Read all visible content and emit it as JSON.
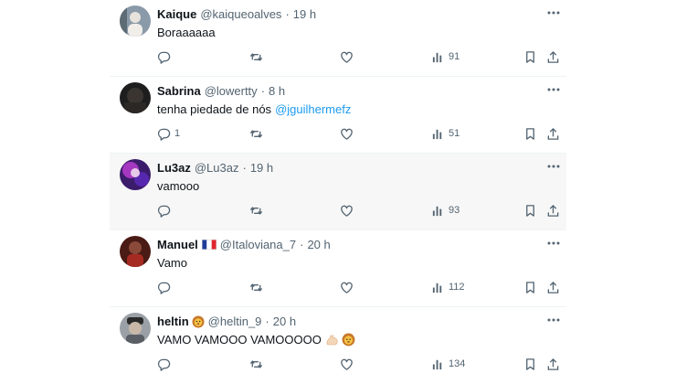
{
  "colors": {
    "text": "#0f1419",
    "secondary": "#536471",
    "link": "#1d9bf0",
    "highlight_bg": "#f7f7f7"
  },
  "tweets": [
    {
      "name": "Kaique",
      "handle": "@kaiqueoalves",
      "dot": "·",
      "time": "19 h",
      "text": "Boraaaaaa",
      "replies": "",
      "views": "91"
    },
    {
      "name": "Sabrina",
      "handle": "@lowertty",
      "dot": "·",
      "time": "8 h",
      "text": "tenha piedade de nós",
      "mention": "@jguilhermefz",
      "replies": "1",
      "views": "51"
    },
    {
      "name": "Lu3az",
      "handle": "@Lu3az",
      "dot": "·",
      "time": "19 h",
      "text": "vamooo",
      "replies": "",
      "views": "93"
    },
    {
      "name": "Manuel",
      "flag_icon": "france-flag-icon",
      "handle": "@Italoviana_7",
      "dot": "·",
      "time": "20 h",
      "text": "Vamo",
      "replies": "",
      "views": "112"
    },
    {
      "name": "heltin",
      "name_emoji_icon": "lion-emoji-icon",
      "handle": "@heltin_9",
      "dot": "·",
      "time": "20 h",
      "text": "VAMO VAMOOO VAMOOOOO",
      "text_emojis": [
        "flexed-biceps-emoji-icon",
        "lion-emoji-icon"
      ],
      "replies": "",
      "views": "134"
    }
  ]
}
